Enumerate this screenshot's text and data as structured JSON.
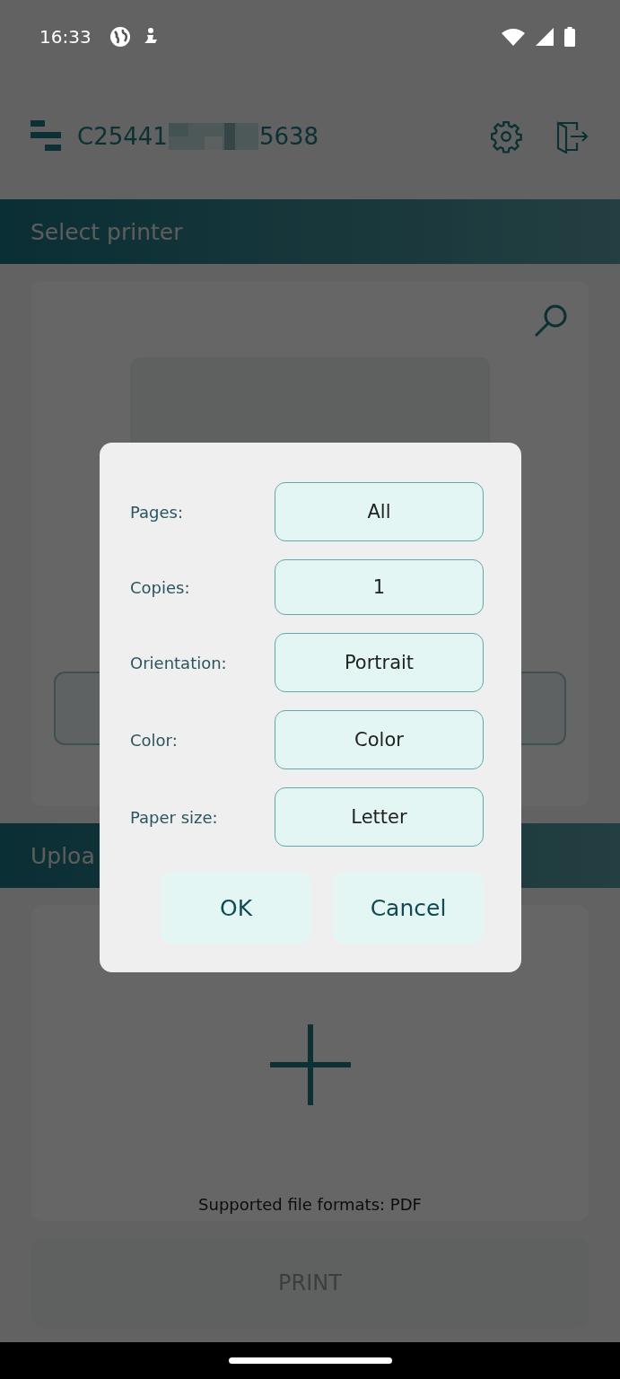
{
  "status_bar": {
    "time": "16:33"
  },
  "header": {
    "title_start": "C25441",
    "title_end": "5638"
  },
  "sections": [
    {
      "title": "Select printer"
    },
    {
      "title": "Uploa"
    }
  ],
  "upload": {
    "hint": "Supported file formats: PDF"
  },
  "print_button": {
    "label": "PRINT",
    "disabled": true
  },
  "dialog": {
    "rows": [
      {
        "label": "Pages:",
        "value": "All"
      },
      {
        "label": "Copies:",
        "value": "1"
      },
      {
        "label": "Orientation:",
        "value": "Portrait"
      },
      {
        "label": "Color:",
        "value": "Color"
      },
      {
        "label": "Paper size:",
        "value": "Letter"
      }
    ],
    "buttons": [
      "OK",
      "Cancel"
    ]
  }
}
